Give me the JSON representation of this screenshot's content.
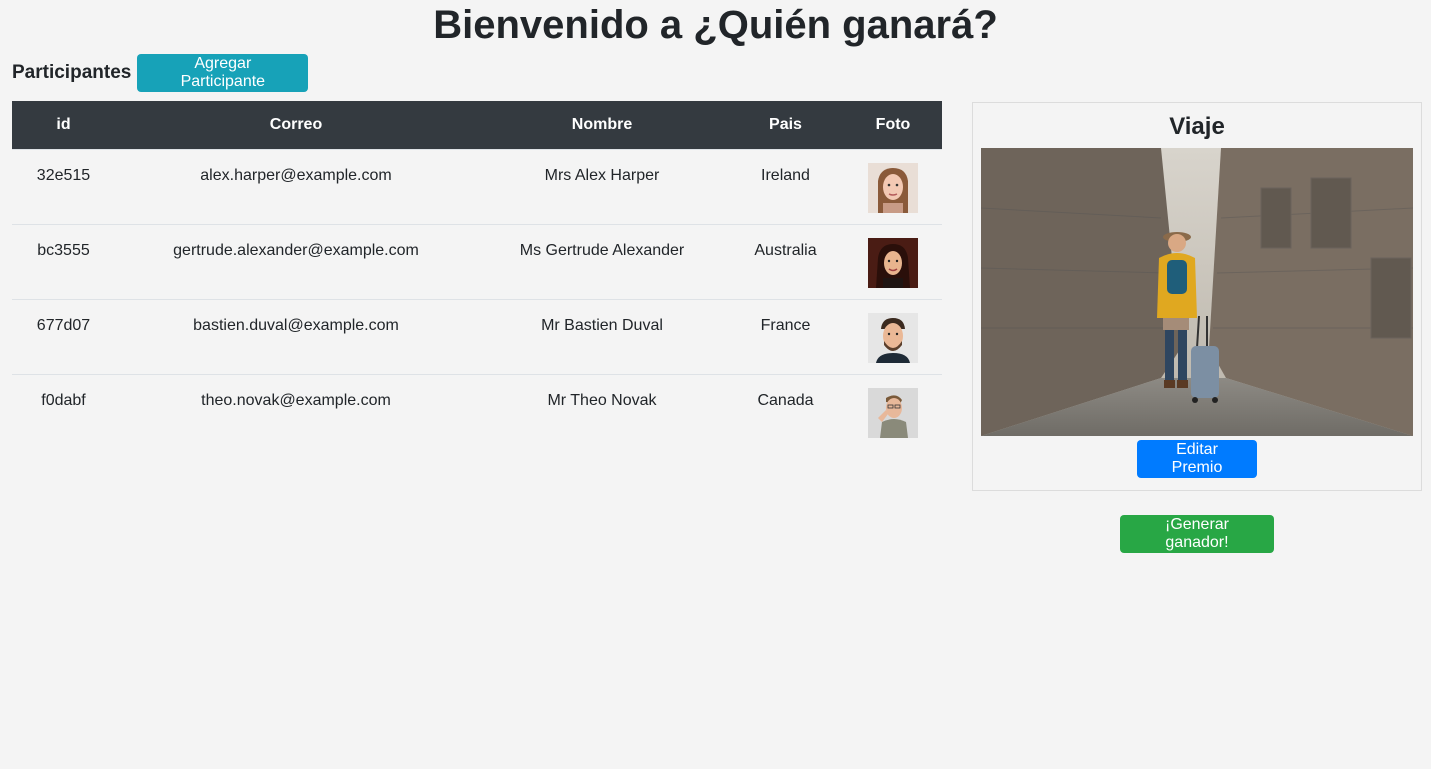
{
  "page": {
    "title": "Bienvenido a ¿Quién ganará?"
  },
  "participants_section": {
    "label": "Participantes",
    "add_button_label": "Agregar Participante"
  },
  "table": {
    "headers": {
      "id": "id",
      "email": "Correo",
      "name": "Nombre",
      "country": "Pais",
      "photo": "Foto"
    },
    "rows": [
      {
        "id": "32e515",
        "email": "alex.harper@example.com",
        "name": "Mrs Alex Harper",
        "country": "Ireland",
        "photo": "avatar-woman-light-hair"
      },
      {
        "id": "bc3555",
        "email": "gertrude.alexander@example.com",
        "name": "Ms Gertrude Alexander",
        "country": "Australia",
        "photo": "avatar-woman-dark-hair"
      },
      {
        "id": "677d07",
        "email": "bastien.duval@example.com",
        "name": "Mr Bastien Duval",
        "country": "France",
        "photo": "avatar-man-beard"
      },
      {
        "id": "f0dabf",
        "email": "theo.novak@example.com",
        "name": "Mr Theo Novak",
        "country": "Canada",
        "photo": "avatar-man-glasses"
      }
    ]
  },
  "prize": {
    "title": "Viaje",
    "image": "traveler-with-suitcase-in-old-street-photo",
    "edit_button_label": "Editar Premio"
  },
  "actions": {
    "generate_winner_label": "¡Generar ganador!"
  },
  "colors": {
    "header_dark": "#343a40",
    "info": "#17a2b8",
    "primary": "#007bff",
    "success": "#28a745",
    "background": "#f4f4f4"
  }
}
